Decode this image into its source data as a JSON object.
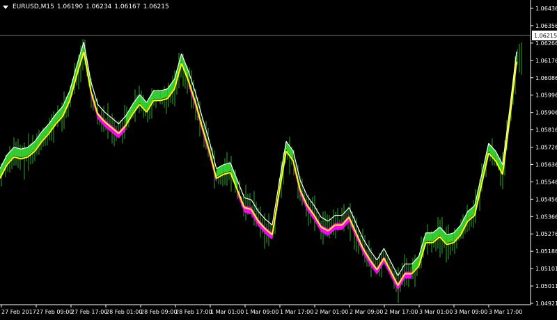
{
  "header": {
    "symbol": "EURUSD,M15",
    "open": "1.06190",
    "high": "1.06234",
    "low": "1.06167",
    "close": "1.06215"
  },
  "colors": {
    "background": "#000000",
    "axis": "#ffffff",
    "candles": "#1e8f1e",
    "band_up": "#32cd32",
    "band_down": "#ff00ff",
    "ma_up": "#ffffff",
    "ma_down": "#ffff00"
  },
  "chart_data": {
    "type": "line",
    "title": "",
    "xlabel": "",
    "ylabel": "",
    "ylim": [
      1.04921,
      1.06436
    ],
    "current_price": "1.06215",
    "y_ticks": [
      "1.06436",
      "1.06356",
      "1.06266",
      "1.06176",
      "1.06086",
      "1.05996",
      "1.05906",
      "1.05816",
      "1.05726",
      "1.05636",
      "1.05546",
      "1.05456",
      "1.05366",
      "1.05276",
      "1.05186",
      "1.05101",
      "1.05011",
      "1.04921"
    ],
    "x_ticks": [
      "27 Feb 2017",
      "27 Feb 09:00",
      "27 Feb 17:00",
      "28 Feb 01:00",
      "28 Feb 09:00",
      "28 Feb 17:00",
      "1 Mar 01:00",
      "1 Mar 09:00",
      "1 Mar 17:00",
      "2 Mar 01:00",
      "2 Mar 09:00",
      "2 Mar 17:00",
      "3 Mar 01:00",
      "3 Mar 09:00",
      "3 Mar 17:00"
    ],
    "series": [
      {
        "x": [
          0,
          10,
          20,
          30,
          40,
          50,
          60,
          70,
          80,
          90,
          100,
          110,
          120,
          130,
          140,
          150,
          160,
          170,
          180,
          190,
          200,
          210,
          220,
          230,
          240,
          250,
          260,
          270,
          280,
          290,
          300,
          310,
          320,
          330,
          340,
          350,
          360,
          370,
          380,
          390,
          400,
          410,
          420,
          430,
          440,
          450,
          460,
          470,
          480,
          490,
          500,
          510,
          520,
          530,
          540,
          550,
          560,
          570,
          580,
          590,
          600,
          610,
          620,
          630,
          640,
          650,
          660,
          670,
          680,
          690,
          700,
          710,
          720,
          730,
          740
        ],
        "price": [
          1.0557,
          1.0564,
          1.0568,
          1.0567,
          1.0568,
          1.0571,
          1.0576,
          1.058,
          1.0585,
          1.0589,
          1.0597,
          1.061,
          1.0622,
          1.0602,
          1.059,
          1.0586,
          1.0583,
          1.058,
          1.0584,
          1.059,
          1.0595,
          1.0591,
          1.0597,
          1.0597,
          1.0598,
          1.0603,
          1.0616,
          1.0607,
          1.0596,
          1.0583,
          1.0571,
          1.0557,
          1.0559,
          1.056,
          1.0551,
          1.0542,
          1.0541,
          1.0535,
          1.0531,
          1.0528,
          1.055,
          1.0571,
          1.0566,
          1.0551,
          1.0543,
          1.0538,
          1.0532,
          1.053,
          1.0533,
          1.0533,
          1.0537,
          1.0529,
          1.0521,
          1.0515,
          1.051,
          1.0516,
          1.0509,
          1.0502,
          1.0508,
          1.0508,
          1.0512,
          1.0524,
          1.0524,
          1.0527,
          1.0523,
          1.0524,
          1.0528,
          1.0535,
          1.0538,
          1.0554,
          1.057,
          1.0566,
          1.0559,
          1.0587,
          1.0617
        ],
        "trend": [
          "up",
          "up",
          "up",
          "up",
          "up",
          "up",
          "up",
          "up",
          "up",
          "up",
          "up",
          "up",
          "up",
          "down",
          "down",
          "down",
          "down",
          "down",
          "up",
          "up",
          "up",
          "up",
          "up",
          "up",
          "up",
          "up",
          "up",
          "down",
          "down",
          "down",
          "down",
          "up",
          "up",
          "up",
          "down",
          "down",
          "down",
          "down",
          "down",
          "down",
          "up",
          "up",
          "down",
          "down",
          "down",
          "down",
          "down",
          "down",
          "down",
          "down",
          "down",
          "down",
          "down",
          "down",
          "down",
          "down",
          "down",
          "down",
          "down",
          "up",
          "up",
          "up",
          "up",
          "up",
          "up",
          "up",
          "up",
          "up",
          "up",
          "up",
          "up",
          "up",
          "up",
          "up",
          "up"
        ]
      }
    ]
  }
}
